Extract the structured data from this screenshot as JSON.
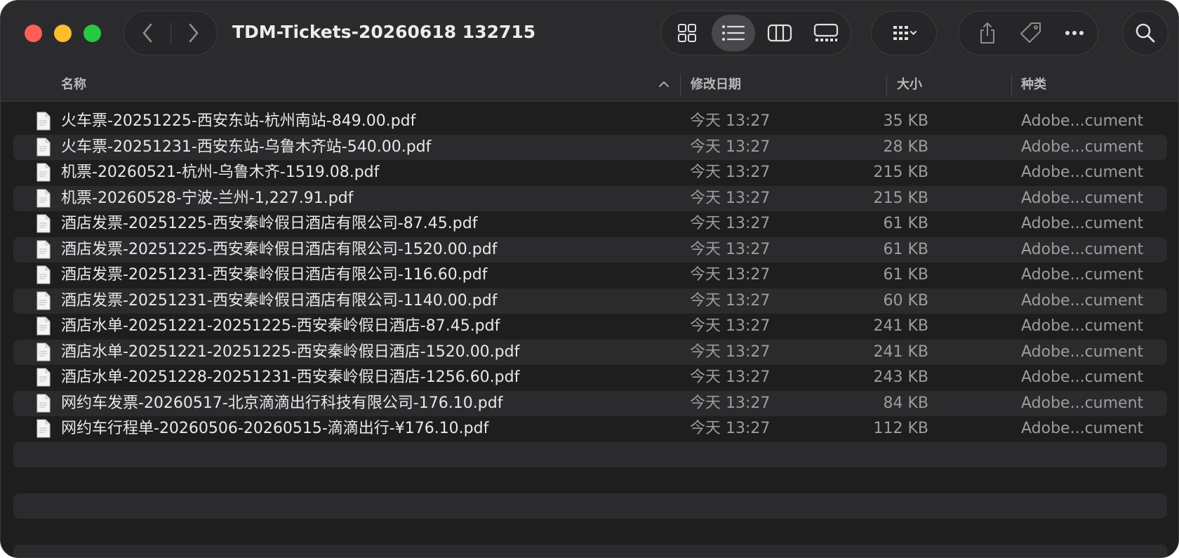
{
  "window": {
    "title": "TDM-Tickets-20260618 132715"
  },
  "toolbar": {
    "back_icon": "chevron-left-icon",
    "forward_icon": "chevron-right-icon",
    "views": [
      "icon-view-icon",
      "list-view-icon",
      "column-view-icon",
      "gallery-view-icon"
    ],
    "active_view": "list-view-icon",
    "group_icon": "group-by-icon",
    "share_icon": "share-icon",
    "tag_icon": "tag-icon",
    "more_icon": "more-icon",
    "search_icon": "search-icon"
  },
  "columns": {
    "name": "名称",
    "date": "修改日期",
    "size": "大小",
    "kind": "种类"
  },
  "files": [
    {
      "name": "火车票-20251225-西安东站-杭州南站-849.00.pdf",
      "date": "今天 13:27",
      "size": "35 KB",
      "kind": "Adobe...cument"
    },
    {
      "name": "火车票-20251231-西安东站-乌鲁木齐站-540.00.pdf",
      "date": "今天 13:27",
      "size": "28 KB",
      "kind": "Adobe...cument"
    },
    {
      "name": "机票-20260521-杭州-乌鲁木齐-1519.08.pdf",
      "date": "今天 13:27",
      "size": "215 KB",
      "kind": "Adobe...cument"
    },
    {
      "name": "机票-20260528-宁波-兰州-1,227.91.pdf",
      "date": "今天 13:27",
      "size": "215 KB",
      "kind": "Adobe...cument"
    },
    {
      "name": "酒店发票-20251225-西安秦岭假日酒店有限公司-87.45.pdf",
      "date": "今天 13:27",
      "size": "61 KB",
      "kind": "Adobe...cument"
    },
    {
      "name": "酒店发票-20251225-西安秦岭假日酒店有限公司-1520.00.pdf",
      "date": "今天 13:27",
      "size": "61 KB",
      "kind": "Adobe...cument"
    },
    {
      "name": "酒店发票-20251231-西安秦岭假日酒店有限公司-116.60.pdf",
      "date": "今天 13:27",
      "size": "61 KB",
      "kind": "Adobe...cument"
    },
    {
      "name": "酒店发票-20251231-西安秦岭假日酒店有限公司-1140.00.pdf",
      "date": "今天 13:27",
      "size": "60 KB",
      "kind": "Adobe...cument"
    },
    {
      "name": "酒店水单-20251221-20251225-西安秦岭假日酒店-87.45.pdf",
      "date": "今天 13:27",
      "size": "241 KB",
      "kind": "Adobe...cument"
    },
    {
      "name": "酒店水单-20251221-20251225-西安秦岭假日酒店-1520.00.pdf",
      "date": "今天 13:27",
      "size": "241 KB",
      "kind": "Adobe...cument"
    },
    {
      "name": "酒店水单-20251228-20251231-西安秦岭假日酒店-1256.60.pdf",
      "date": "今天 13:27",
      "size": "243 KB",
      "kind": "Adobe...cument"
    },
    {
      "name": "网约车发票-20260517-北京滴滴出行科技有限公司-176.10.pdf",
      "date": "今天 13:27",
      "size": "84 KB",
      "kind": "Adobe...cument"
    },
    {
      "name": "网约车行程单-20260506-20260515-滴滴出行-¥176.10.pdf",
      "date": "今天 13:27",
      "size": "112 KB",
      "kind": "Adobe...cument"
    }
  ]
}
